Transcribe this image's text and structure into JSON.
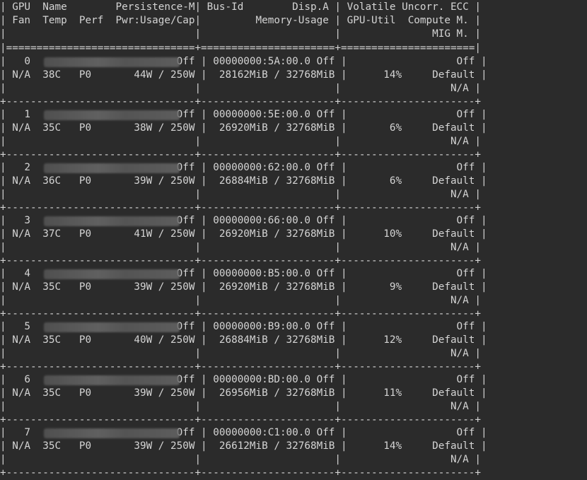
{
  "header": {
    "line1": "| GPU  Name        Persistence-M| Bus-Id        Disp.A | Volatile Uncorr. ECC |",
    "line2": "| Fan  Temp  Perf  Pwr:Usage/Cap|         Memory-Usage | GPU-Util  Compute M. |",
    "line3": "|                               |                      |               MIG M. |",
    "separator": "|===============================+======================+======================|"
  },
  "gpus": [
    {
      "index": "0",
      "fan": "N/A",
      "temp": "38C",
      "perf": "P0",
      "persistence": "Off",
      "power": "44W / 250W",
      "bus_id": "00000000:5A:00.0",
      "disp": "Off",
      "memory": "28162MiB / 32768MiB",
      "util": "14%",
      "ecc": "Off",
      "compute": "Default",
      "mig": "N/A"
    },
    {
      "index": "1",
      "fan": "N/A",
      "temp": "35C",
      "perf": "P0",
      "persistence": "Off",
      "power": "38W / 250W",
      "bus_id": "00000000:5E:00.0",
      "disp": "Off",
      "memory": "26920MiB / 32768MiB",
      "util": "6%",
      "ecc": "Off",
      "compute": "Default",
      "mig": "N/A"
    },
    {
      "index": "2",
      "fan": "N/A",
      "temp": "36C",
      "perf": "P0",
      "persistence": "Off",
      "power": "39W / 250W",
      "bus_id": "00000000:62:00.0",
      "disp": "Off",
      "memory": "26884MiB / 32768MiB",
      "util": "6%",
      "ecc": "Off",
      "compute": "Default",
      "mig": "N/A"
    },
    {
      "index": "3",
      "fan": "N/A",
      "temp": "37C",
      "perf": "P0",
      "persistence": "Off",
      "power": "41W / 250W",
      "bus_id": "00000000:66:00.0",
      "disp": "Off",
      "memory": "26920MiB / 32768MiB",
      "util": "10%",
      "ecc": "Off",
      "compute": "Default",
      "mig": "N/A"
    },
    {
      "index": "4",
      "fan": "N/A",
      "temp": "35C",
      "perf": "P0",
      "persistence": "Off",
      "power": "39W / 250W",
      "bus_id": "00000000:B5:00.0",
      "disp": "Off",
      "memory": "26920MiB / 32768MiB",
      "util": "9%",
      "ecc": "Off",
      "compute": "Default",
      "mig": "N/A"
    },
    {
      "index": "5",
      "fan": "N/A",
      "temp": "35C",
      "perf": "P0",
      "persistence": "Off",
      "power": "40W / 250W",
      "bus_id": "00000000:B9:00.0",
      "disp": "Off",
      "memory": "26884MiB / 32768MiB",
      "util": "12%",
      "ecc": "Off",
      "compute": "Default",
      "mig": "N/A"
    },
    {
      "index": "6",
      "fan": "N/A",
      "temp": "35C",
      "perf": "P0",
      "persistence": "Off",
      "power": "39W / 250W",
      "bus_id": "00000000:BD:00.0",
      "disp": "Off",
      "memory": "26956MiB / 32768MiB",
      "util": "11%",
      "ecc": "Off",
      "compute": "Default",
      "mig": "N/A"
    },
    {
      "index": "7",
      "fan": "N/A",
      "temp": "35C",
      "perf": "P0",
      "persistence": "Off",
      "power": "39W / 250W",
      "bus_id": "00000000:C1:00.0",
      "disp": "Off",
      "memory": "26612MiB / 32768MiB",
      "util": "14%",
      "ecc": "Off",
      "compute": "Default",
      "mig": "N/A"
    }
  ],
  "row_separator": "+-------------------------------+----------------------+----------------------+"
}
